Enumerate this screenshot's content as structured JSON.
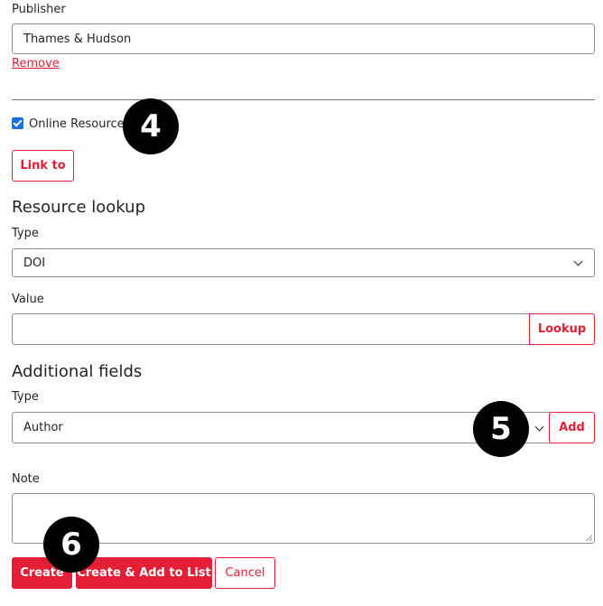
{
  "publisher": {
    "label": "Publisher",
    "value": "Thames & Hudson",
    "remove_link": "Remove"
  },
  "online_resource": {
    "label": "Online Resource",
    "checked": true,
    "link_button": "Link to"
  },
  "resource_lookup": {
    "heading": "Resource lookup",
    "type_label": "Type",
    "type_selected": "DOI",
    "value_label": "Value",
    "value": "",
    "lookup_button": "Lookup"
  },
  "additional_fields": {
    "heading": "Additional fields",
    "type_label": "Type",
    "type_selected": "Author",
    "add_button": "Add"
  },
  "note": {
    "label": "Note",
    "value": ""
  },
  "actions": {
    "create": "Create",
    "create_add_list": "Create & Add to List",
    "cancel": "Cancel"
  },
  "annotations": {
    "step4": "4",
    "step5": "5",
    "step6": "6"
  },
  "colors": {
    "accent": "#e41f35",
    "checkbox": "#1a6fe0",
    "badge": "#000000"
  }
}
